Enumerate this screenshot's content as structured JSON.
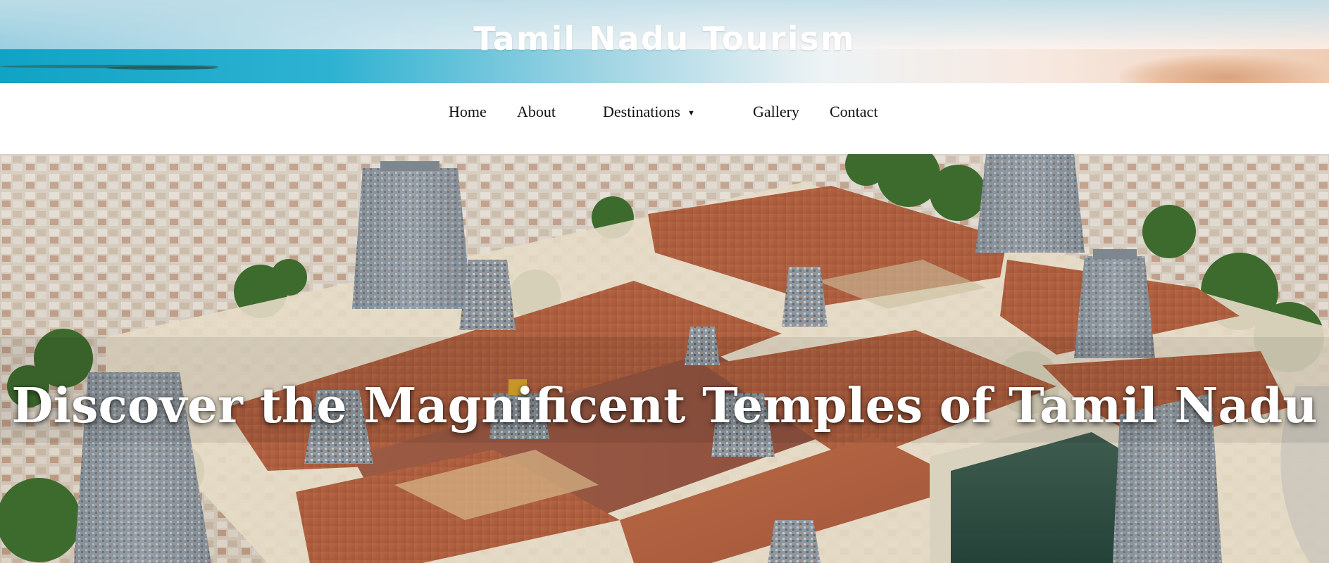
{
  "site": {
    "title": "Tamil Nadu Tourism"
  },
  "nav": {
    "items": [
      {
        "label": "Home"
      },
      {
        "label": "About"
      },
      {
        "label": "Destinations",
        "has_dropdown": true,
        "caret": "▼"
      },
      {
        "label": "Gallery"
      },
      {
        "label": "Contact"
      }
    ]
  },
  "hero": {
    "heading": "Discover the Magnificent Temples of Tamil Nadu",
    "image_subject": "aerial view of temple complex with gopurams"
  },
  "colors": {
    "nav_text": "#111111",
    "title_text": "#ffffff",
    "hero_text": "#ffffff",
    "roof_terracotta": "#b8673f"
  }
}
